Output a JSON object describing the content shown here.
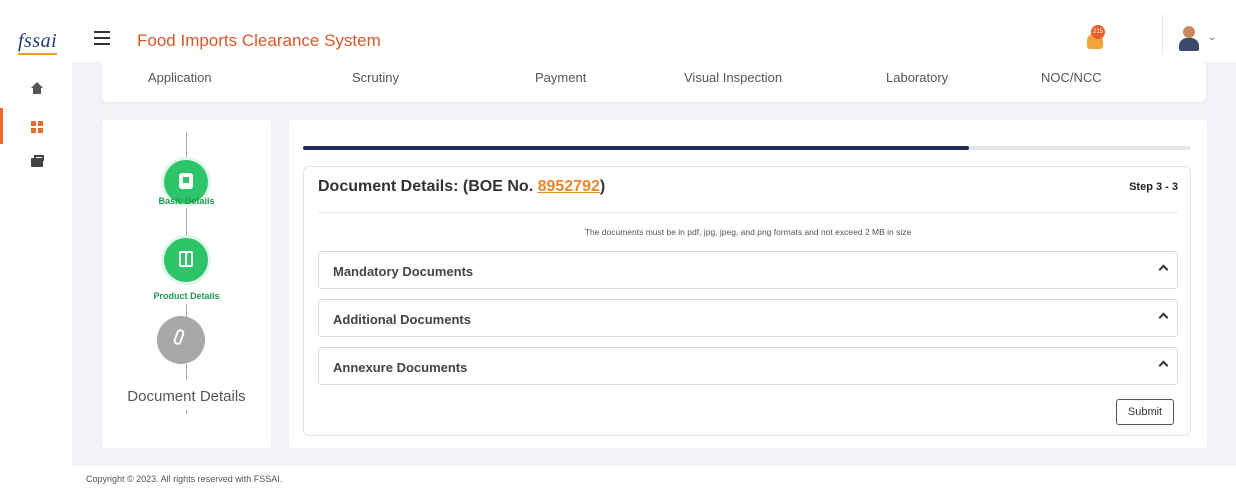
{
  "header": {
    "logo_text": "fssai",
    "title": "Food Imports Clearance System",
    "notification_count": "215",
    "icons": [
      "menu-icon",
      "bell-icon",
      "user-avatar",
      "chevron-down-icon"
    ]
  },
  "sidebar": {
    "items": [
      {
        "icon": "home-icon"
      },
      {
        "icon": "dashboard-grid-icon",
        "active": true
      },
      {
        "icon": "briefcase-icon"
      }
    ]
  },
  "stages": [
    "Application",
    "Scrutiny",
    "Payment",
    "Visual Inspection",
    "Laboratory",
    "NOC/NCC"
  ],
  "stepper": {
    "steps": [
      {
        "label": "Basic Details",
        "icon": "document-icon",
        "status": "completed"
      },
      {
        "label": "Product Details",
        "icon": "box-icon",
        "status": "completed"
      },
      {
        "label": "Document Details",
        "icon": "paperclip-icon",
        "status": "current"
      }
    ]
  },
  "progress_fraction": 0.75,
  "document_section": {
    "title_prefix": "Document Details: (BOE No. ",
    "boe_number": "8952792",
    "title_suffix": ")",
    "step_indicator": "Step 3 - 3",
    "note": "The documents must be in pdf, jpg, jpeg, and png formats and not exceed 2 MB in size",
    "accordions": [
      {
        "label": "Mandatory Documents"
      },
      {
        "label": "Additional Documents"
      },
      {
        "label": "Annexure Documents"
      }
    ],
    "submit_label": "Submit"
  },
  "footer": {
    "copyright": "Copyright © 2023. All rights reserved with FSSAI."
  },
  "colors": {
    "accent": "#e86a2c",
    "success": "#2ec46a",
    "progress": "#1f2f5a",
    "link": "#e8862c"
  }
}
